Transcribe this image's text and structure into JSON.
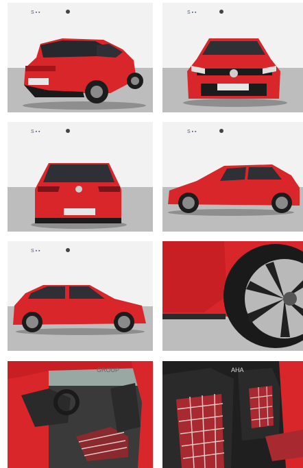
{
  "gallery": {
    "photos": [
      {
        "view": "rear three-quarter"
      },
      {
        "view": "front"
      },
      {
        "view": "rear"
      },
      {
        "view": "side left"
      },
      {
        "view": "side right"
      },
      {
        "view": "wheel detail"
      },
      {
        "view": "interior front seats"
      },
      {
        "view": "seats detail"
      }
    ]
  },
  "watermark": {
    "interior_text": "GROUP",
    "seat_text": "AHA"
  },
  "colors": {
    "car_red": "#d9262b",
    "studio_floor": "#bdbdbd",
    "studio_wall": "#f3f3f3",
    "tartan_red": "#b8252c",
    "seat_black": "#2a2a2a"
  }
}
